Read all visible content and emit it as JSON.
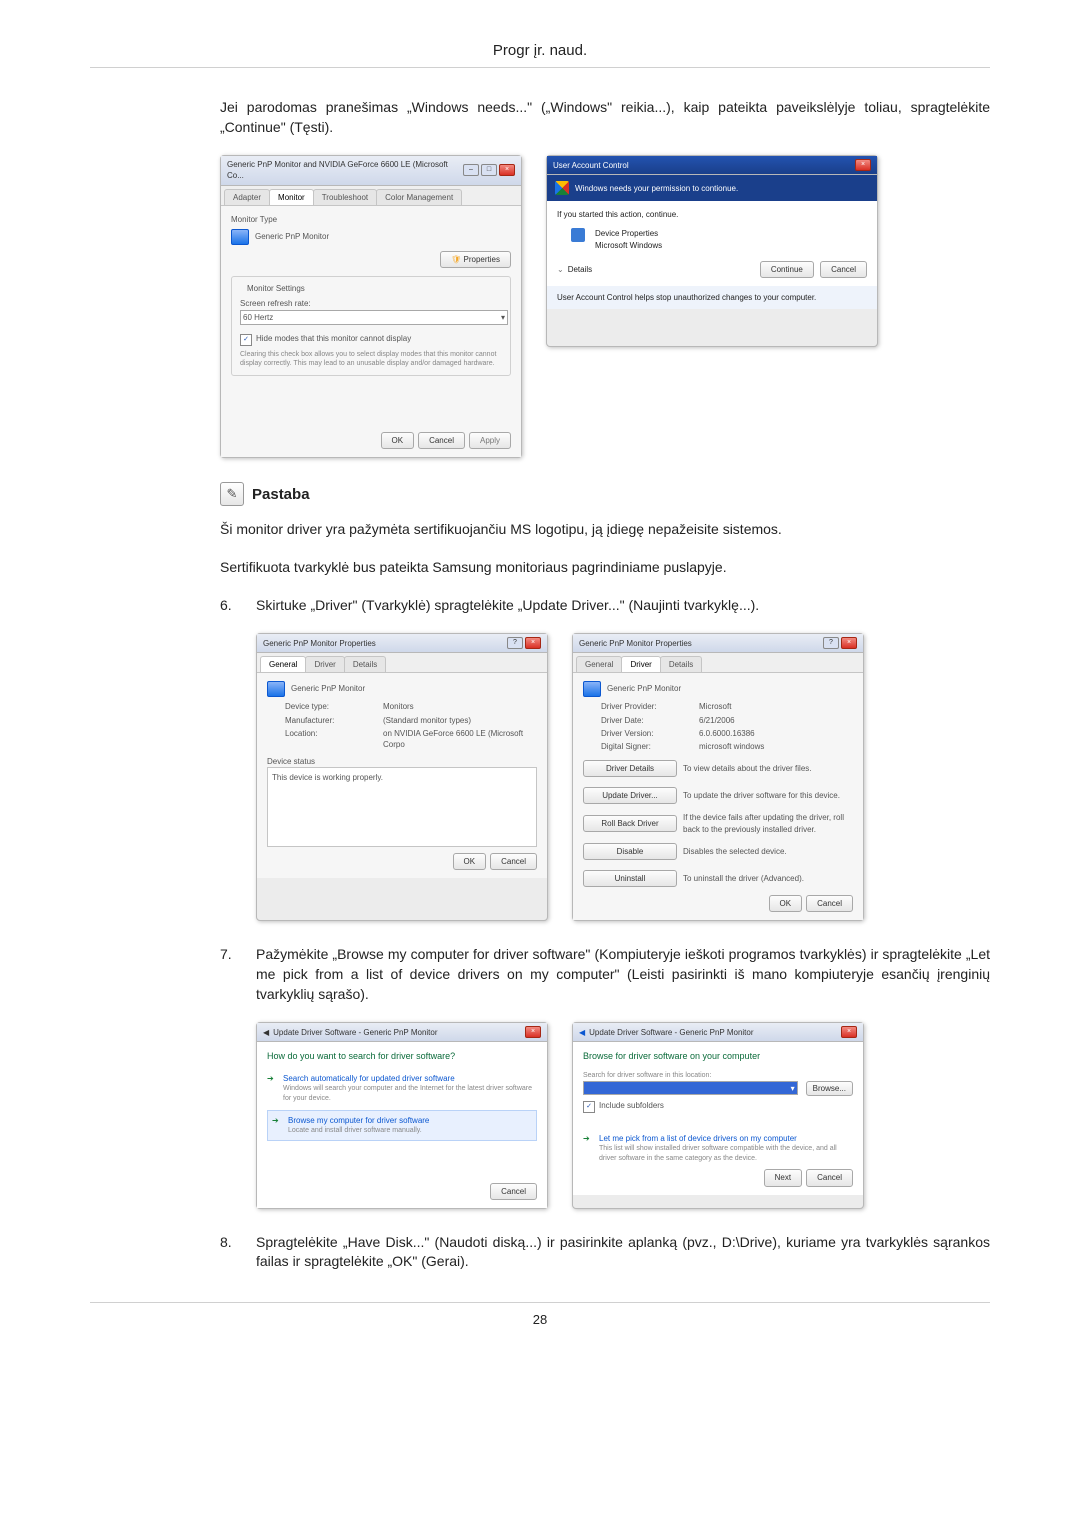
{
  "header": {
    "title": "Progr įr. naud."
  },
  "footer": {
    "page": "28"
  },
  "intro": {
    "para": "Jei parodomas pranešimas „Windows needs...\" („Windows\" reikia...), kaip pateikta paveikslėlyje toliau, spragtelėkite „Continue\" (Tęsti)."
  },
  "fig1": {
    "left": {
      "title": "Generic PnP Monitor and NVIDIA GeForce 6600 LE (Microsoft Co...",
      "tabs": {
        "adapter": "Adapter",
        "monitor": "Monitor",
        "troubleshoot": "Troubleshoot",
        "colormgmt": "Color Management"
      },
      "monitor_type_label": "Monitor Type",
      "monitor_name": "Generic PnP Monitor",
      "properties_btn": "Properties",
      "settings_label": "Monitor Settings",
      "refresh_label": "Screen refresh rate:",
      "refresh_value": "60 Hertz",
      "hide_modes_chk": "Hide modes that this monitor cannot display",
      "hide_modes_note": "Clearing this check box allows you to select display modes that this monitor cannot display correctly. This may lead to an unusable display and/or damaged hardware.",
      "ok": "OK",
      "cancel": "Cancel",
      "apply": "Apply"
    },
    "right": {
      "title": "User Account Control",
      "headline": "Windows needs your permission to contionue.",
      "started": "If you started this action, continue.",
      "item1": "Device Properties",
      "item2": "Microsoft Windows",
      "details": "Details",
      "continue": "Continue",
      "cancel": "Cancel",
      "footer": "User Account Control helps stop unauthorized changes to your computer."
    }
  },
  "note": {
    "label": "Pastaba",
    "p1": "Ši monitor driver yra pažymėta sertifikuojančiu MS logotipu, ją įdiegę nepažeisite sistemos.",
    "p2": "Sertifikuota tvarkyklė bus pateikta Samsung monitoriaus pagrindiniame puslapyje."
  },
  "step6": {
    "num": "6.",
    "text": "Skirtuke „Driver\" (Tvarkyklė) spragtelėkite „Update Driver...\" (Naujinti tvarkyklę...)."
  },
  "fig2": {
    "left": {
      "title": "Generic PnP Monitor Properties",
      "tabs": {
        "general": "General",
        "driver": "Driver",
        "details": "Details"
      },
      "monitor_name": "Generic PnP Monitor",
      "dev_type_l": "Device type:",
      "dev_type_v": "Monitors",
      "manu_l": "Manufacturer:",
      "manu_v": "(Standard monitor types)",
      "loc_l": "Location:",
      "loc_v": "on NVIDIA GeForce 6600 LE (Microsoft Corpo",
      "status_label": "Device status",
      "status_text": "This device is working properly.",
      "ok": "OK",
      "cancel": "Cancel"
    },
    "right": {
      "title": "Generic PnP Monitor Properties",
      "tabs": {
        "general": "General",
        "driver": "Driver",
        "details": "Details"
      },
      "monitor_name": "Generic PnP Monitor",
      "prov_l": "Driver Provider:",
      "prov_v": "Microsoft",
      "date_l": "Driver Date:",
      "date_v": "6/21/2006",
      "ver_l": "Driver Version:",
      "ver_v": "6.0.6000.16386",
      "sign_l": "Digital Signer:",
      "sign_v": "microsoft windows",
      "b_details": "Driver Details",
      "b_details_d": "To view details about the driver files.",
      "b_update": "Update Driver...",
      "b_update_d": "To update the driver software for this device.",
      "b_roll": "Roll Back Driver",
      "b_roll_d": "If the device fails after updating the driver, roll back to the previously installed driver.",
      "b_disable": "Disable",
      "b_disable_d": "Disables the selected device.",
      "b_uninstall": "Uninstall",
      "b_uninstall_d": "To uninstall the driver (Advanced).",
      "ok": "OK",
      "cancel": "Cancel"
    }
  },
  "step7": {
    "num": "7.",
    "text": "Pažymėkite „Browse my computer for driver software\" (Kompiuteryje ieškoti programos tvarkyklės) ir spragtelėkite „Let me pick from a list of device drivers on my computer\" (Leisti pasirinkti iš mano kompiuteryje esančių įrenginių tvarkyklių sąrašo)."
  },
  "fig3": {
    "left": {
      "bc": "Update Driver Software - Generic PnP Monitor",
      "q": "How do you want to search for driver software?",
      "opt1_t": "Search automatically for updated driver software",
      "opt1_d": "Windows will search your computer and the Internet for the latest driver software for your device.",
      "opt2_t": "Browse my computer for driver software",
      "opt2_d": "Locate and install driver software manually.",
      "cancel": "Cancel"
    },
    "right": {
      "bc": "Update Driver Software - Generic PnP Monitor",
      "h": "Browse for driver software on your computer",
      "loc_l": "Search for driver software in this location:",
      "browse": "Browse...",
      "include": "Include subfolders",
      "pick_t": "Let me pick from a list of device drivers on my computer",
      "pick_d": "This list will show installed driver software compatible with the device, and all driver software in the same category as the device.",
      "next": "Next",
      "cancel": "Cancel"
    }
  },
  "step8": {
    "num": "8.",
    "text": "Spragtelėkite „Have Disk...\" (Naudoti diską...) ir pasirinkite aplanką (pvz., D:\\Drive), kuriame yra tvarkyklės sąrankos failas ir spragtelėkite „OK\" (Gerai)."
  }
}
